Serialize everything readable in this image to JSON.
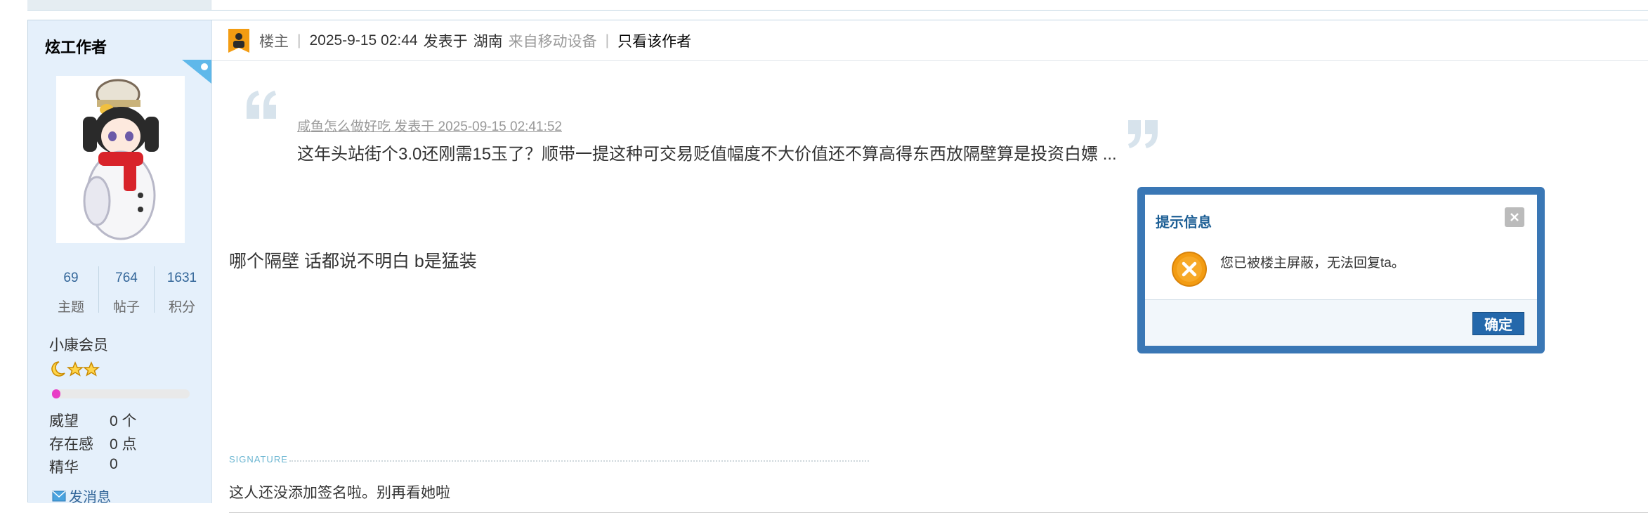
{
  "author": {
    "name": "炫工作者",
    "stats": [
      {
        "num": "69",
        "label": "主题"
      },
      {
        "num": "764",
        "label": "帖子"
      },
      {
        "num": "1631",
        "label": "积分"
      }
    ],
    "group": "小康会员",
    "level_progress": 0.05,
    "info": [
      {
        "key": "威望",
        "value": "0 个"
      },
      {
        "key": "存在感",
        "value": "0 点"
      },
      {
        "key": "精华",
        "value": "0"
      }
    ],
    "message_label": "发消息"
  },
  "post": {
    "role": "楼主",
    "time": "2025-9-15 02:44",
    "posted_at": "发表于",
    "location": "湖南",
    "source": "来自移动设备",
    "only_author": "只看该作者",
    "quote": {
      "by": "咸鱼怎么做好吃 发表于 2025-09-15 02:41:52",
      "text": "这年头站街个3.0还刚需15玉了？顺带一提这种可交易贬值幅度不大价值还不算高得东西放隔壁算是投资白嫖 ..."
    },
    "body": "哪个隔壁 话都说不明白 b是猛装",
    "signature_label": "SIGNATURE",
    "signature": "这人还没添加签名啦。别再看她啦"
  },
  "dialog": {
    "title": "提示信息",
    "message": "您已被楼主屏蔽，无法回复ta。",
    "ok_label": "确定"
  },
  "colors": {
    "sidebar_bg": "#e5f0fb",
    "link": "#336699",
    "dialog_border": "#3a77b5",
    "ok_button": "#2468ab",
    "warning": "#f39c12",
    "progress": "#e83ec6"
  }
}
